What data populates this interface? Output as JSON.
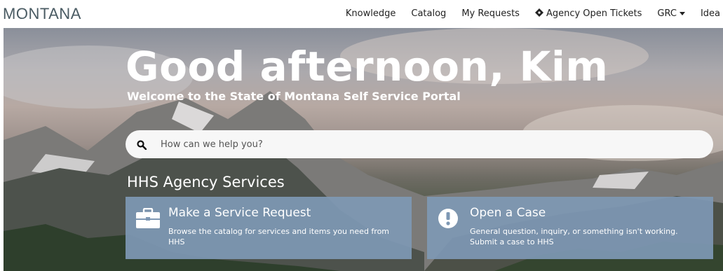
{
  "header": {
    "logo": "MONTANA",
    "nav": [
      {
        "label": "Knowledge"
      },
      {
        "label": "Catalog"
      },
      {
        "label": "My Requests"
      },
      {
        "label": "Agency Open Tickets",
        "icon": "ticket-icon"
      },
      {
        "label": "GRC",
        "dropdown": true
      },
      {
        "label": "Idea"
      }
    ]
  },
  "hero": {
    "greeting": "Good afternoon, Kim",
    "welcome": "Welcome to the State of Montana Self Service Portal",
    "search": {
      "placeholder": "How can we help you?",
      "icon": "search-icon"
    }
  },
  "services": {
    "title": "HHS Agency Services",
    "cards": [
      {
        "title": "Make a Service Request",
        "description": "Browse the catalog for services and items you need from HHS",
        "icon": "briefcase-icon"
      },
      {
        "title": "Open a Case",
        "description": "General question, inquiry, or something isn't working. Submit a case to HHS",
        "icon": "exclamation-icon"
      }
    ]
  },
  "colors": {
    "card_bg": "#7e98b4",
    "logo": "#4a5b63"
  }
}
